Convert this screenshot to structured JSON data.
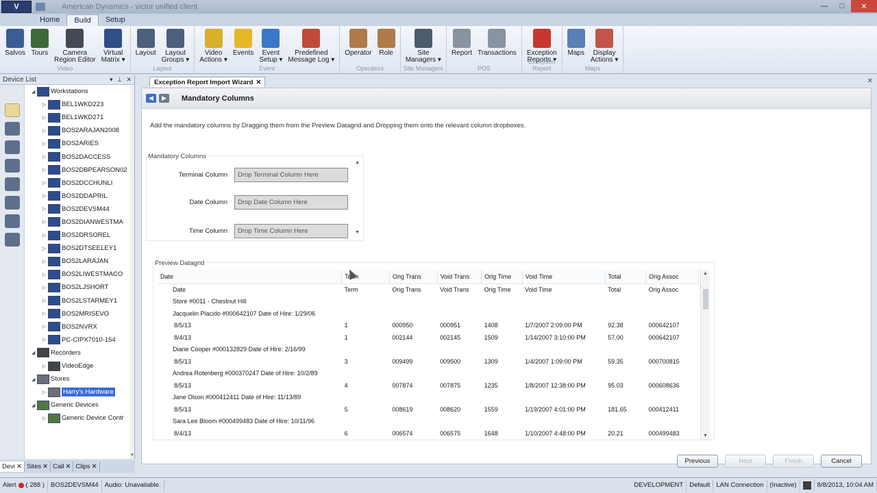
{
  "app": {
    "logo": "V",
    "title": "American Dynamics - victor unified client",
    "win": {
      "minimize": "—",
      "maximize": "□",
      "close": "✕"
    }
  },
  "ribbon_tabs": [
    "Home",
    "Build",
    "Setup"
  ],
  "ribbon_groups": [
    {
      "label": "Video",
      "items": [
        {
          "label": "Salvos",
          "color": "#3b5d96"
        },
        {
          "label": "Tours",
          "color": "#3d6a3a"
        },
        {
          "label": "Camera\nRegion Editor",
          "color": "#444a55"
        },
        {
          "label": "Virtual\nMatrix ▾",
          "color": "#2f4f8a"
        }
      ]
    },
    {
      "label": "Layout",
      "items": [
        {
          "label": "Layout",
          "color": "#4c5f7d"
        },
        {
          "label": "Layout\nGroups ▾",
          "color": "#4c5f7d"
        }
      ]
    },
    {
      "label": "Event",
      "items": [
        {
          "label": "Video\nActions ▾",
          "color": "#d9b02b"
        },
        {
          "label": "Events",
          "color": "#e7b726"
        },
        {
          "label": "Event\nSetup ▾",
          "color": "#3a78c9"
        },
        {
          "label": "Predefined\nMessage Log ▾",
          "color": "#c04a3a"
        }
      ]
    },
    {
      "label": "Operators",
      "items": [
        {
          "label": "Operator",
          "color": "#b07a4a"
        },
        {
          "label": "Role",
          "color": "#b07a4a"
        }
      ]
    },
    {
      "label": "Site Managers",
      "items": [
        {
          "label": "Site\nManagers ▾",
          "color": "#4e5b6c"
        }
      ]
    },
    {
      "label": "POS",
      "items": [
        {
          "label": "Report",
          "color": "#8a93a0"
        },
        {
          "label": "Transactions",
          "color": "#8a93a0"
        }
      ]
    },
    {
      "label": "Exception Report",
      "items": [
        {
          "label": "Exception\nReports ▾",
          "color": "#c8372f"
        }
      ]
    },
    {
      "label": "Maps",
      "items": [
        {
          "label": "Maps",
          "color": "#5a7fb7"
        },
        {
          "label": "Display\nActions ▾",
          "color": "#c3554a"
        }
      ]
    }
  ],
  "device_panel": {
    "title": "Device List",
    "controls": [
      "▾",
      "⊥",
      "✕"
    ],
    "tree": [
      {
        "label": "Workstations",
        "level": 0,
        "exp": "◢",
        "icon": "ws"
      },
      {
        "label": "BEL1WKD223",
        "level": 1,
        "exp": "▷",
        "icon": "ws"
      },
      {
        "label": "BEL1WKD271",
        "level": 1,
        "exp": "▷",
        "icon": "ws"
      },
      {
        "label": "BOS2ARAJAN2008",
        "level": 1,
        "exp": "▷",
        "icon": "ws"
      },
      {
        "label": "BOS2ARIES",
        "level": 1,
        "exp": "▷",
        "icon": "ws"
      },
      {
        "label": "BOS2DACCESS",
        "level": 1,
        "exp": "▷",
        "icon": "ws"
      },
      {
        "label": "BOS2DBPEARSON02",
        "level": 1,
        "exp": "▷",
        "icon": "ws"
      },
      {
        "label": "BOS2DCCHUNLI",
        "level": 1,
        "exp": "▷",
        "icon": "ws"
      },
      {
        "label": "BOS2DDAPRIL",
        "level": 1,
        "exp": "▷",
        "icon": "ws"
      },
      {
        "label": "BOS2DEVSM44",
        "level": 1,
        "exp": "▷",
        "icon": "ws"
      },
      {
        "label": "BOS2DIANWESTMA",
        "level": 1,
        "exp": "▷",
        "icon": "ws"
      },
      {
        "label": "BOS2DRSOREL",
        "level": 1,
        "exp": "▷",
        "icon": "ws"
      },
      {
        "label": "BOS2DTSEELEY1",
        "level": 1,
        "exp": "▷",
        "icon": "ws"
      },
      {
        "label": "BOS2LARAJAN",
        "level": 1,
        "exp": "▷",
        "icon": "ws"
      },
      {
        "label": "BOS2LIWESTMACO",
        "level": 1,
        "exp": "▷",
        "icon": "ws"
      },
      {
        "label": "BOS2LJSHORT",
        "level": 1,
        "exp": "▷",
        "icon": "ws"
      },
      {
        "label": "BOS2LSTARMEY1",
        "level": 1,
        "exp": "▷",
        "icon": "ws"
      },
      {
        "label": "BOS2MRISEVO",
        "level": 1,
        "exp": "▷",
        "icon": "ws"
      },
      {
        "label": "BOS2NVRX",
        "level": 1,
        "exp": "▷",
        "icon": "ws"
      },
      {
        "label": "PC-CIPX7010-154",
        "level": 1,
        "exp": "▷",
        "icon": "ws"
      },
      {
        "label": "Recorders",
        "level": 0,
        "exp": "◢",
        "icon": "rec"
      },
      {
        "label": "VideoEdge",
        "level": 1,
        "exp": "▷",
        "icon": "rec"
      },
      {
        "label": "Stores",
        "level": 0,
        "exp": "◢",
        "icon": "store"
      },
      {
        "label": "Harry's Hardware",
        "level": 1,
        "exp": "▷",
        "icon": "store",
        "selected": true
      },
      {
        "label": "Generic Devices",
        "level": 0,
        "exp": "◢",
        "icon": "generic"
      },
      {
        "label": "Generic Device Contr",
        "level": 1,
        "exp": "▷",
        "icon": "generic"
      }
    ]
  },
  "bottom_tabs": [
    {
      "label": "Devi",
      "active": true
    },
    {
      "label": "Sites"
    },
    {
      "label": "Call"
    },
    {
      "label": "Clips"
    }
  ],
  "bottom_tab_close": "✕",
  "document": {
    "tab_title": "Exception Report Import Wizard",
    "tab_close": "✕",
    "close_all": "✕",
    "nav": {
      "back": "◀",
      "forward": "▶"
    },
    "wizard_title": "Mandatory Columns",
    "description": "Add the mandatory columns by Dragging them from the Preview Datagrid and Dropping them onto the relevant column dropboxes.",
    "mandatory_group_label": "Mandatory Columns",
    "fields": [
      {
        "label": "Terminal Column",
        "placeholder": "Drop Terminal Column Here"
      },
      {
        "label": "Date Column",
        "placeholder": "Drop Date Column Here"
      },
      {
        "label": "Time Column",
        "placeholder": "Drop Time Column Here"
      }
    ],
    "preview_label": "Preview Datagrid",
    "grid": {
      "headers": [
        "Date",
        "Term",
        "Orig Trans",
        "Void Trans",
        "Orig Time",
        "Void Time",
        "Total",
        "Orig Assoc"
      ],
      "rows": [
        {
          "type": "cells",
          "cells": [
            "Date",
            "Term",
            "Orig Trans",
            "Void Trans",
            "Orig Time",
            "Void Time",
            "Total",
            "Orig Assoc"
          ]
        },
        {
          "type": "full",
          "text": "Store #0011 - Chestnut Hill"
        },
        {
          "type": "full",
          "text": "Jacquelin Placido #000642107   Date of Hire: 1/29/06"
        },
        {
          "type": "cells",
          "cells": [
            "8/5/13",
            "1",
            "000950",
            "000951",
            "1408",
            "1/7/2007 2:09:00 PM",
            "92.38",
            "000642107"
          ]
        },
        {
          "type": "cells",
          "cells": [
            "8/4/13",
            "1",
            "002144",
            "002145",
            "1509",
            "1/14/2007 3:10:00 PM",
            "57.00",
            "000642107"
          ]
        },
        {
          "type": "full",
          "text": "Diane Cooper #000132829   Date of Hire: 2/16/99"
        },
        {
          "type": "cells",
          "cells": [
            "8/5/13",
            "3",
            "009499",
            "009500",
            "1309",
            "1/4/2007 1:09:00 PM",
            "59.35",
            "000700815"
          ]
        },
        {
          "type": "full",
          "text": "Andrea Rotenberg #000370247   Date of Hire: 10/2/89"
        },
        {
          "type": "cells",
          "cells": [
            "8/5/13",
            "4",
            "007874",
            "007875",
            "1235",
            "1/8/2007 12:38:00 PM",
            "95.03",
            "000608636"
          ]
        },
        {
          "type": "full",
          "text": "Jane Olson #000412411   Date of Hire: 11/13/89"
        },
        {
          "type": "cells",
          "cells": [
            "8/5/13",
            "5",
            "008619",
            "008620",
            "1559",
            "1/19/2007 4:01:00 PM",
            "181.65",
            "000412411"
          ]
        },
        {
          "type": "full",
          "text": "Sara Lee Bloom #000499483   Date of Hire: 10/11/96"
        },
        {
          "type": "cells",
          "cells": [
            "8/4/13",
            "6",
            "006574",
            "006575",
            "1648",
            "1/10/2007 4:48:00 PM",
            "20.21",
            "000499483"
          ]
        }
      ]
    },
    "buttons": [
      {
        "label": "Previous",
        "enabled": true
      },
      {
        "label": "Next",
        "enabled": false
      },
      {
        "label": "Finish",
        "enabled": false
      },
      {
        "label": "Cancel",
        "enabled": true
      }
    ]
  },
  "statusbar": {
    "alert": "Alert",
    "alert_count": "( 288 )",
    "machine": "BOS2DEVSM44",
    "audio": "Audio: Unavailable.",
    "environment": "DEVELOPMENT",
    "profile": "Default",
    "connection": "LAN Connection",
    "state": "(Inactive)",
    "datetime": "8/8/2013, 10:04 AM"
  }
}
